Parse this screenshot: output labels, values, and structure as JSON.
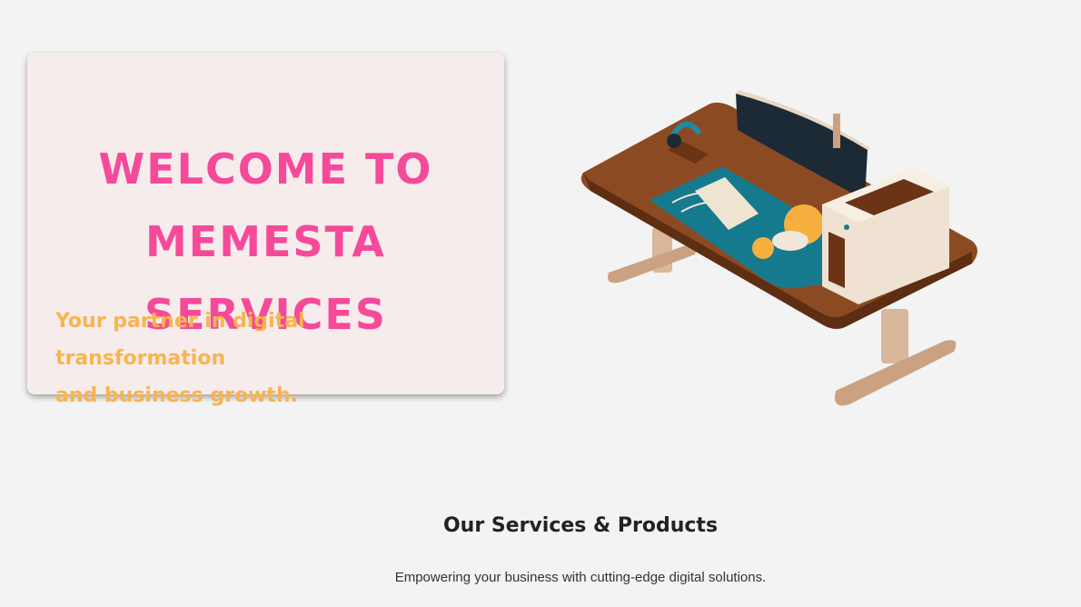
{
  "hero": {
    "title_lines": [
      "WELCOME TO",
      "MEMESTA",
      "SERVICES"
    ],
    "tagline_lines": [
      "Your partner in digital transformation",
      "and business growth."
    ],
    "colors": {
      "title": "#f54a9a",
      "tagline": "#f8b44f",
      "card_bg": "#f6ecec"
    }
  },
  "illustration": {
    "icon": "desk-workstation-illustration"
  },
  "services": {
    "title": "Our Services & Products",
    "subtitle": "Empowering your business with cutting-edge digital solutions."
  }
}
